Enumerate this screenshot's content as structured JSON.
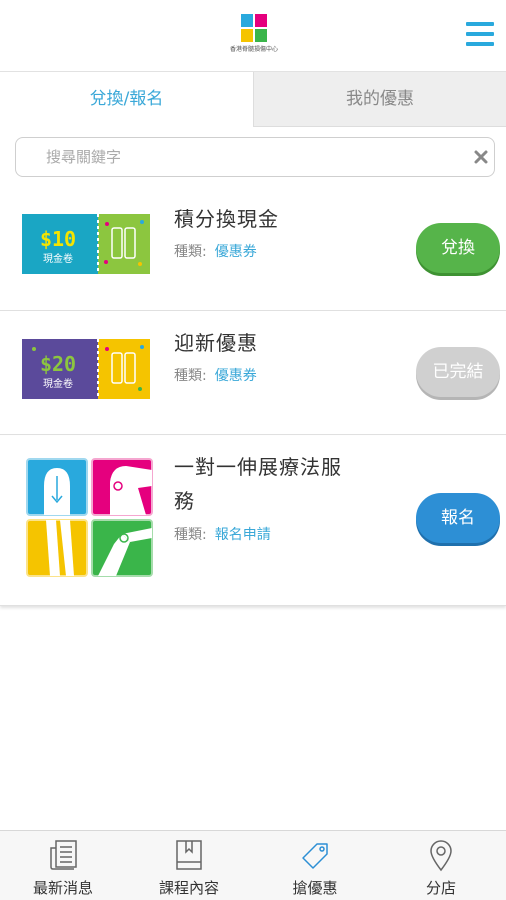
{
  "header": {
    "logo_text": "香港脊髓損傷中心",
    "menu_icon": "hamburger-menu-icon",
    "accent_color": "#29a9dd"
  },
  "tabs": [
    {
      "label": "兌換/報名",
      "active": true
    },
    {
      "label": "我的優惠",
      "active": false
    }
  ],
  "search": {
    "placeholder": "搜尋關鍵字",
    "value": "",
    "clear_icon": "close-icon"
  },
  "items": [
    {
      "title_line1": "積分換現金",
      "title_line2": "",
      "type_label": "種類:",
      "type_value": "優惠券",
      "button_label": "兌換",
      "button_color": "#56b44a",
      "thumb": {
        "amount": "$10",
        "caption": "現金卷"
      }
    },
    {
      "title_line1": "迎新優惠",
      "title_line2": "",
      "type_label": "種類:",
      "type_value": "優惠券",
      "button_label": "已完結",
      "button_color": "#d0d0d0",
      "thumb": {
        "amount": "$20",
        "caption": "現金卷"
      }
    },
    {
      "title_line1": "一對一伸展療法服",
      "title_line2": "務",
      "type_label": "種類:",
      "type_value": "報名申請",
      "button_label": "報名",
      "button_color": "#2d8fd5",
      "thumb": {
        "amount": "",
        "caption": ""
      }
    }
  ],
  "bottom_nav": [
    {
      "label": "最新消息",
      "icon": "newspaper-icon"
    },
    {
      "label": "課程內容",
      "icon": "book-icon"
    },
    {
      "label": "搶優惠",
      "icon": "tag-icon"
    },
    {
      "label": "分店",
      "icon": "location-pin-icon"
    }
  ]
}
